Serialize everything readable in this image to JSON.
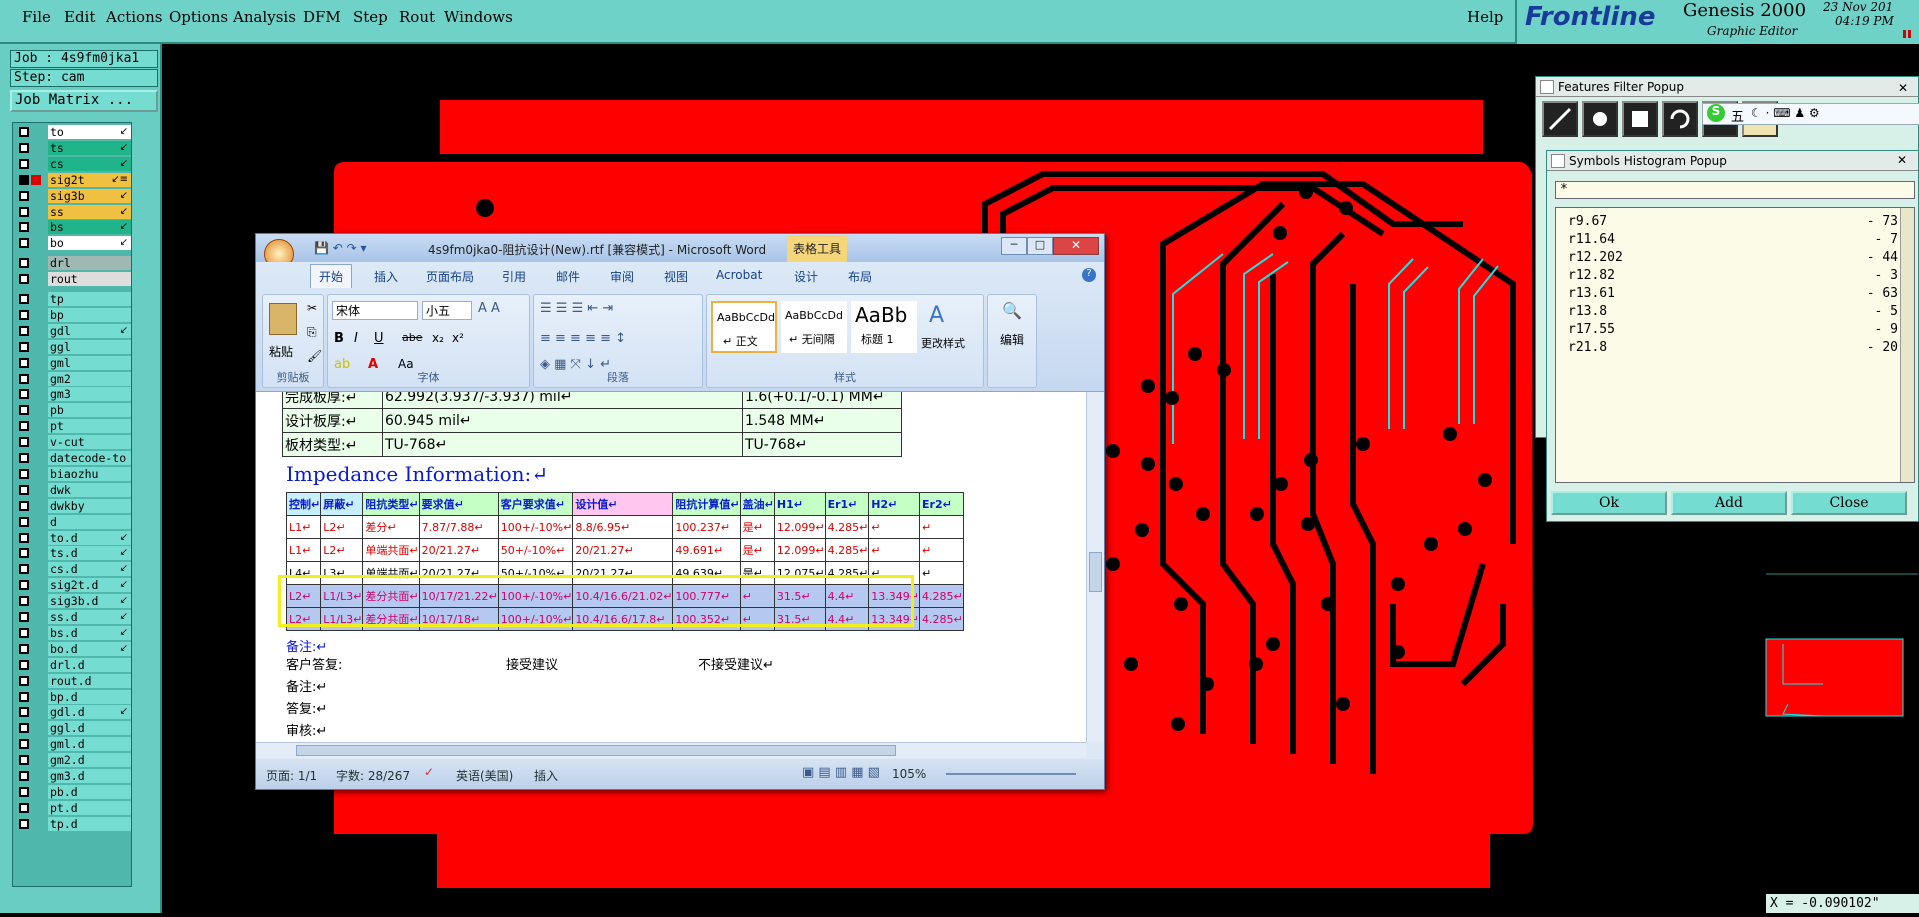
{
  "menu": [
    "File",
    "Edit",
    "Actions",
    "Options",
    "Analysis",
    "DFM",
    "Step",
    "Rout",
    "Windows"
  ],
  "help": "Help",
  "logo": {
    "brand": "Frontline",
    "product": "Genesis 2000",
    "subtitle": "Graphic Editor",
    "date": "23 Nov 201",
    "time": "04:19 PM"
  },
  "left": {
    "job": "Job : 4s9fm0jka1",
    "step": "Step: cam",
    "matrix": "Job Matrix ..."
  },
  "layers": [
    {
      "name": "to",
      "color": "#ffffff",
      "mark": "↙"
    },
    {
      "name": "ts",
      "color": "#1fb48a",
      "mark": "↙"
    },
    {
      "name": "cs",
      "color": "#1fb48a",
      "mark": "↙"
    },
    {
      "name": "sig2t",
      "color": "#f0c040",
      "mark": "↙≡"
    },
    {
      "name": "sig3b",
      "color": "#f0c040",
      "mark": "↙"
    },
    {
      "name": "ss",
      "color": "#f0c040",
      "mark": "↙"
    },
    {
      "name": "bs",
      "color": "#1fb48a",
      "mark": "↙"
    },
    {
      "name": "bo",
      "color": "#ffffff",
      "mark": "↙"
    },
    {
      "name": "drl",
      "color": "#9fb8b4",
      "mark": ""
    },
    {
      "name": "rout",
      "color": "#dddddd",
      "mark": ""
    },
    {
      "name": "tp",
      "color": "#74dcd0",
      "mark": ""
    },
    {
      "name": "bp",
      "color": "#74dcd0",
      "mark": ""
    },
    {
      "name": "gdl",
      "color": "#74dcd0",
      "mark": "↙"
    },
    {
      "name": "ggl",
      "color": "#74dcd0",
      "mark": ""
    },
    {
      "name": "gml",
      "color": "#74dcd0",
      "mark": ""
    },
    {
      "name": "gm2",
      "color": "#74dcd0",
      "mark": ""
    },
    {
      "name": "gm3",
      "color": "#74dcd0",
      "mark": ""
    },
    {
      "name": "pb",
      "color": "#74dcd0",
      "mark": ""
    },
    {
      "name": "pt",
      "color": "#74dcd0",
      "mark": ""
    },
    {
      "name": "v-cut",
      "color": "#74dcd0",
      "mark": ""
    },
    {
      "name": "datecode-to",
      "color": "#74dcd0",
      "mark": ""
    },
    {
      "name": "biaozhu",
      "color": "#74dcd0",
      "mark": ""
    },
    {
      "name": "dwk",
      "color": "#74dcd0",
      "mark": ""
    },
    {
      "name": "dwkby",
      "color": "#74dcd0",
      "mark": ""
    },
    {
      "name": "d",
      "color": "#74dcd0",
      "mark": ""
    },
    {
      "name": "to.d",
      "color": "#74dcd0",
      "mark": "↙"
    },
    {
      "name": "ts.d",
      "color": "#74dcd0",
      "mark": "↙"
    },
    {
      "name": "cs.d",
      "color": "#74dcd0",
      "mark": "↙"
    },
    {
      "name": "sig2t.d",
      "color": "#74dcd0",
      "mark": "↙"
    },
    {
      "name": "sig3b.d",
      "color": "#74dcd0",
      "mark": "↙"
    },
    {
      "name": "ss.d",
      "color": "#74dcd0",
      "mark": "↙"
    },
    {
      "name": "bs.d",
      "color": "#74dcd0",
      "mark": "↙"
    },
    {
      "name": "bo.d",
      "color": "#74dcd0",
      "mark": "↙"
    },
    {
      "name": "drl.d",
      "color": "#74dcd0",
      "mark": ""
    },
    {
      "name": "rout.d",
      "color": "#74dcd0",
      "mark": ""
    },
    {
      "name": "bp.d",
      "color": "#74dcd0",
      "mark": ""
    },
    {
      "name": "gdl.d",
      "color": "#74dcd0",
      "mark": "↙"
    },
    {
      "name": "ggl.d",
      "color": "#74dcd0",
      "mark": ""
    },
    {
      "name": "gml.d",
      "color": "#74dcd0",
      "mark": ""
    },
    {
      "name": "gm2.d",
      "color": "#74dcd0",
      "mark": ""
    },
    {
      "name": "gm3.d",
      "color": "#74dcd0",
      "mark": ""
    },
    {
      "name": "pb.d",
      "color": "#74dcd0",
      "mark": ""
    },
    {
      "name": "pt.d",
      "color": "#74dcd0",
      "mark": ""
    },
    {
      "name": "tp.d",
      "color": "#74dcd0",
      "mark": ""
    }
  ],
  "word": {
    "title": "4s9fm0jka0-阻抗设计(New).rtf [兼容模式] - Microsoft Word",
    "context_tab": "表格工具",
    "tabs": [
      "开始",
      "插入",
      "页面布局",
      "引用",
      "邮件",
      "审阅",
      "视图",
      "Acrobat",
      "设计",
      "布局"
    ],
    "font": "宋体",
    "size": "小五",
    "groups": {
      "clipboard": "剪贴板",
      "font": "字体",
      "paragraph": "段落",
      "styles": "样式",
      "edit": "编辑"
    },
    "paste": "粘贴",
    "styles": [
      {
        "preview": "AaBbCcDd",
        "name": "↵ 正文"
      },
      {
        "preview": "AaBbCcDd",
        "name": "↵ 无间隔"
      },
      {
        "preview": "AaBb",
        "name": "标题 1"
      }
    ],
    "change_styles": "更改样式",
    "info_rows": [
      [
        "完成板厚:↵",
        "62.992(3.937/-3.937) mil↵",
        "1.6(+0.1/-0.1) MM↵"
      ],
      [
        "设计板厚:↵",
        "60.945 mil↵",
        "1.548 MM↵"
      ],
      [
        "板材类型:↵",
        "TU-768↵",
        "TU-768↵"
      ]
    ],
    "imp_heading": "Impedance Information:↵",
    "imp_header": [
      "控制↵",
      "屏蔽↵",
      "阻抗类型↵",
      "要求值↵",
      "客户要求值↵",
      "设计值↵",
      "阻抗计算值↵",
      "盖油↵",
      "H1↵",
      "Er1↵",
      "H2↵",
      "Er2↵"
    ],
    "imp_rows": [
      [
        "L1↵",
        "L2↵",
        "差分↵",
        "7.87/7.88↵",
        "100+/-10%↵",
        "8.8/6.95↵",
        "100.237↵",
        "是↵",
        "12.099↵",
        "4.285↵",
        "↵",
        "↵"
      ],
      [
        "L1↵",
        "L2↵",
        "单端共面↵",
        "20/21.27↵",
        "50+/-10%↵",
        "20/21.27↵",
        "49.691↵",
        "是↵",
        "12.099↵",
        "4.285↵",
        "↵",
        "↵"
      ],
      [
        "L4↵",
        "L3↵",
        "单端共面↵",
        "20/21.27↵",
        "50+/-10%↵",
        "20/21.27↵",
        "49.639↵",
        "是↵",
        "12.075↵",
        "4.285↵",
        "↵",
        "↵"
      ],
      [
        "L2↵",
        "L1/L3↵",
        "差分共面↵",
        "10/17/21.22↵",
        "100+/-10%↵",
        "10.4/16.6/21.02↵",
        "100.777↵",
        "↵",
        "31.5↵",
        "4.4↵",
        "13.349↵",
        "4.285↵"
      ],
      [
        "L2↵",
        "L1/L3↵",
        "差分共面↵",
        "10/17/18↵",
        "100+/-10%↵",
        "10.4/16.6/17.8↵",
        "100.352↵",
        "↵",
        "31.5↵",
        "4.4↵",
        "13.349↵",
        "4.285↵"
      ]
    ],
    "notes": [
      "备注:↵",
      "客户答复:",
      "接受建议",
      "不接受建议↵",
      "备注:↵",
      "答复:↵",
      "审核:↵"
    ],
    "status": {
      "page": "页面: 1/1",
      "words": "字数: 28/267",
      "lang": "英语(美国)",
      "mode": "插入",
      "zoom": "105%"
    }
  },
  "features_popup": {
    "title": "Features Filter Popup"
  },
  "histogram": {
    "title": "Symbols Histogram Popup",
    "filter": "*",
    "rows": [
      {
        "sym": "r9.67",
        "count": "- 73"
      },
      {
        "sym": "r11.64",
        "count": "- 7"
      },
      {
        "sym": "r12.202",
        "count": "- 44"
      },
      {
        "sym": "r12.82",
        "count": "- 3"
      },
      {
        "sym": "r13.61",
        "count": "- 63"
      },
      {
        "sym": "r13.8",
        "count": "- 5"
      },
      {
        "sym": "r17.55",
        "count": "- 9"
      },
      {
        "sym": "r21.8",
        "count": "- 20"
      }
    ],
    "buttons": {
      "ok": "Ok",
      "add": "Add",
      "close": "Close"
    }
  },
  "ime": {
    "char": "五"
  },
  "coord": "X = -0.090102\""
}
